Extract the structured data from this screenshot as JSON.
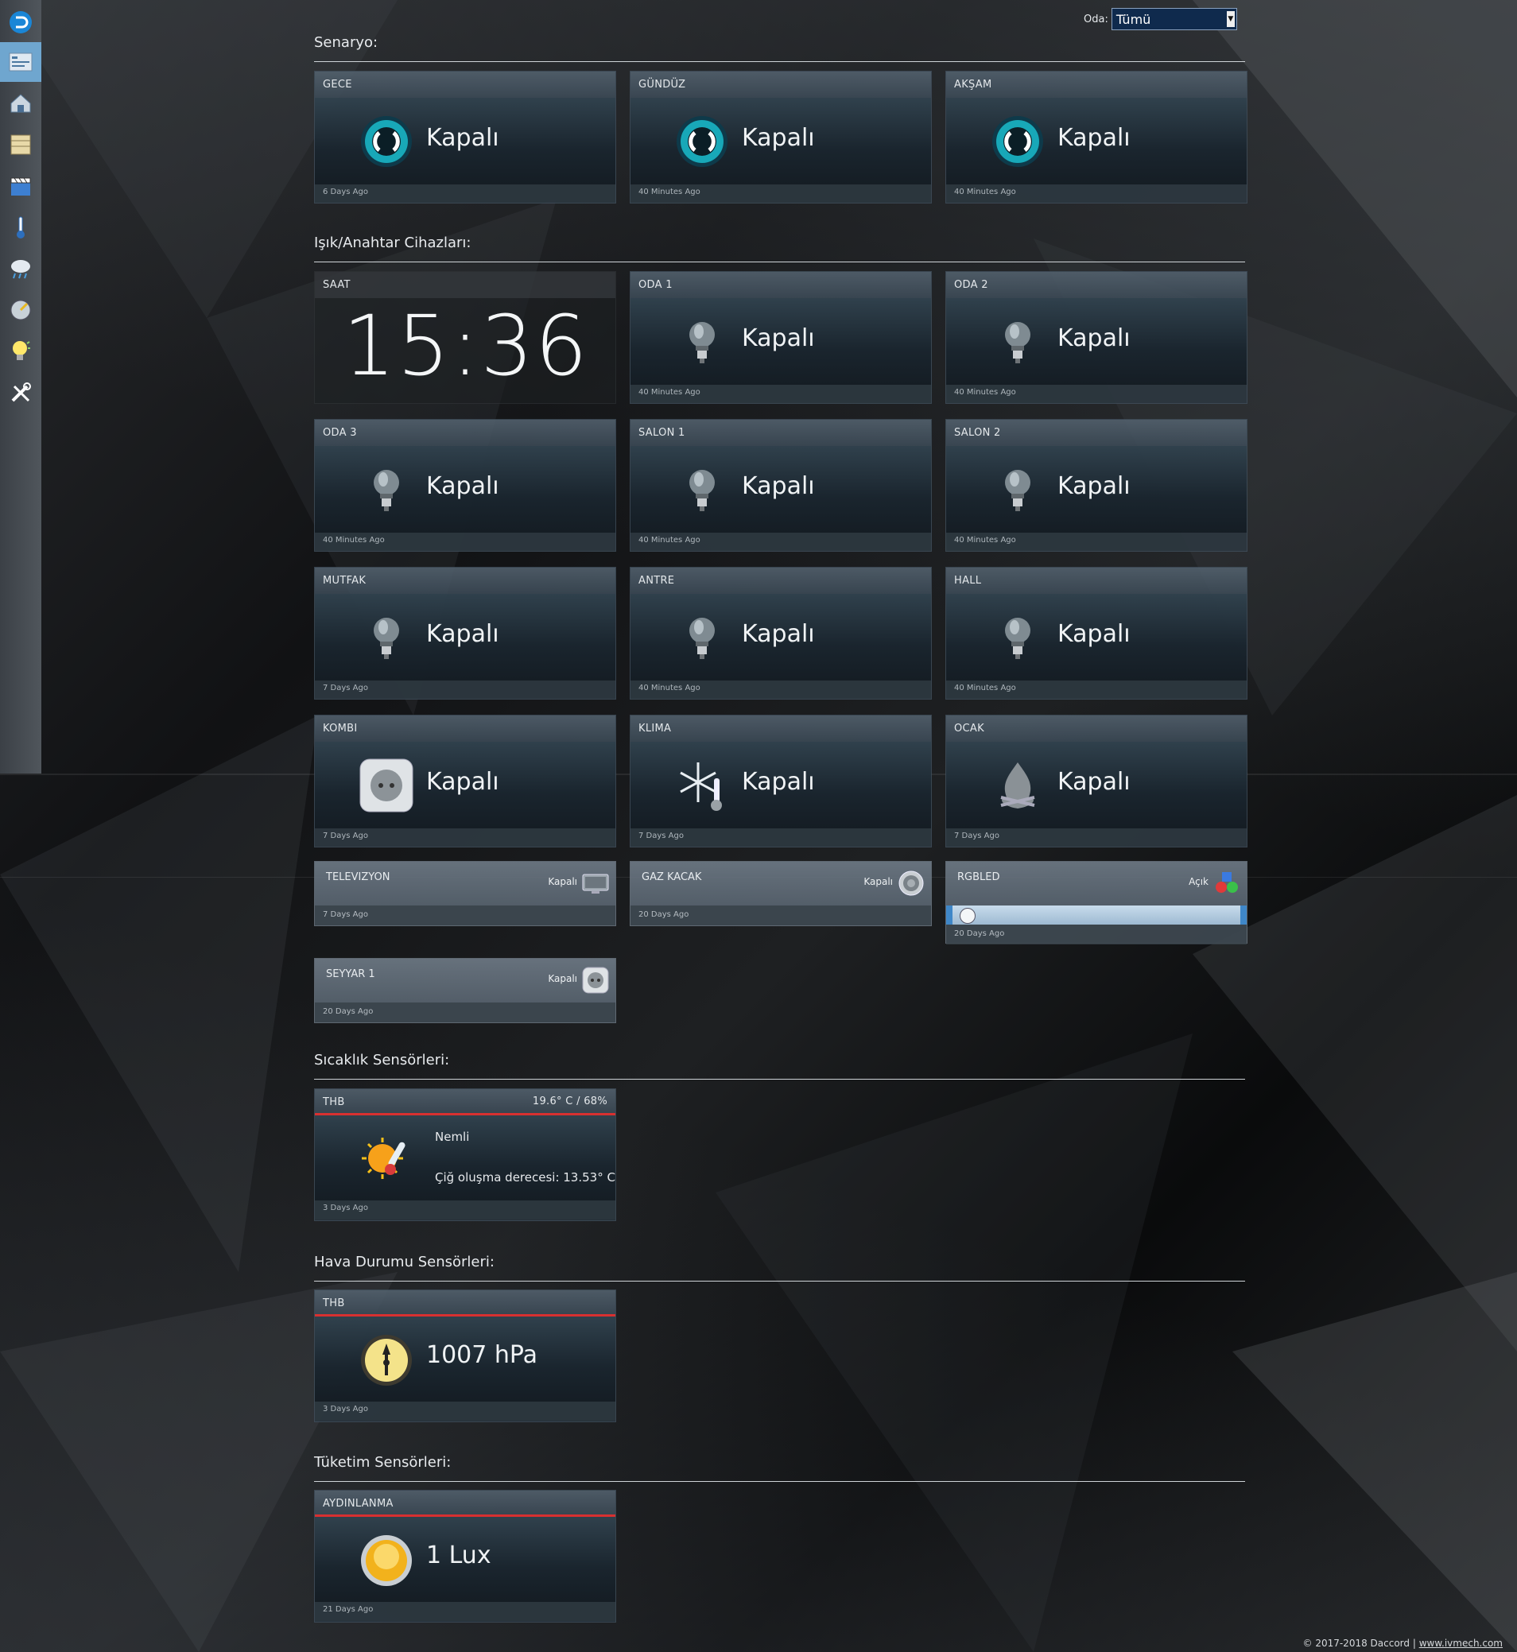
{
  "room_filter": {
    "label": "Oda:",
    "value": "Tümü"
  },
  "sections": {
    "scenario": "Senaryo:",
    "switches": "Işık/Anahtar Cihazları:",
    "temperature": "Sıcaklık Sensörleri:",
    "weather": "Hava Durumu Sensörleri:",
    "consumption": "Tüketim Sensörleri:"
  },
  "scenes": [
    {
      "name": "GECE",
      "state": "Kapalı",
      "updated": "6 Days Ago"
    },
    {
      "name": "GÜNDÜZ",
      "state": "Kapalı",
      "updated": "40 Minutes Ago"
    },
    {
      "name": "AKŞAM",
      "state": "Kapalı",
      "updated": "40 Minutes Ago"
    }
  ],
  "clock": {
    "name": "SAAT",
    "time": "15:36"
  },
  "lights": [
    {
      "name": "ODA 1",
      "state": "Kapalı",
      "updated": "40 Minutes Ago",
      "icon": "bulb-icon"
    },
    {
      "name": "ODA 2",
      "state": "Kapalı",
      "updated": "40 Minutes Ago",
      "icon": "bulb-icon"
    },
    {
      "name": "ODA 3",
      "state": "Kapalı",
      "updated": "40 Minutes Ago",
      "icon": "bulb-icon"
    },
    {
      "name": "SALON 1",
      "state": "Kapalı",
      "updated": "40 Minutes Ago",
      "icon": "bulb-icon"
    },
    {
      "name": "SALON 2",
      "state": "Kapalı",
      "updated": "40 Minutes Ago",
      "icon": "bulb-icon"
    },
    {
      "name": "MUTFAK",
      "state": "Kapalı",
      "updated": "7 Days Ago",
      "icon": "bulb-icon"
    },
    {
      "name": "ANTRE",
      "state": "Kapalı",
      "updated": "40 Minutes Ago",
      "icon": "bulb-icon"
    },
    {
      "name": "HALL",
      "state": "Kapalı",
      "updated": "40 Minutes Ago",
      "icon": "bulb-icon"
    },
    {
      "name": "KOMBI",
      "state": "Kapalı",
      "updated": "7 Days Ago",
      "icon": "socket-icon"
    },
    {
      "name": "KLIMA",
      "state": "Kapalı",
      "updated": "7 Days Ago",
      "icon": "snowflake-icon"
    },
    {
      "name": "OCAK",
      "state": "Kapalı",
      "updated": "7 Days Ago",
      "icon": "fire-icon"
    }
  ],
  "small_devices": [
    {
      "name": "TELEVIZYON",
      "state": "Kapalı",
      "updated": "7 Days Ago",
      "icon": "tv-icon"
    },
    {
      "name": "GAZ KACAK",
      "state": "Kapalı",
      "updated": "20 Days Ago",
      "icon": "gas-sensor-icon"
    },
    {
      "name": "RGBLED",
      "state": "Açık",
      "updated": "20 Days Ago",
      "icon": "rgb-icon",
      "slider_level": 0.02
    },
    {
      "name": "SEYYAR 1",
      "state": "Kapalı",
      "updated": "20 Days Ago",
      "icon": "socket-icon"
    }
  ],
  "temp_sensor": {
    "name": "THB",
    "reading": "19.6° C / 68%",
    "humidity_status": "Nemli",
    "dewpoint": "Çiğ oluşma derecesi: 13.53° C",
    "updated": "3 Days Ago"
  },
  "weather_sensor": {
    "name": "THB",
    "value": "1007 hPa",
    "updated": "3 Days Ago"
  },
  "consumption_sensor": {
    "name": "AYDINLANMA",
    "value": "1 Lux",
    "updated": "21 Days Ago"
  },
  "footer": {
    "copyright": "© 2017-2018 Daccord | ",
    "link": "www.ivmech.com"
  },
  "colors": {
    "accent_red": "#d83030",
    "sidebar_active": "#6fa6cf",
    "select_bg": "#0f2a4d"
  }
}
